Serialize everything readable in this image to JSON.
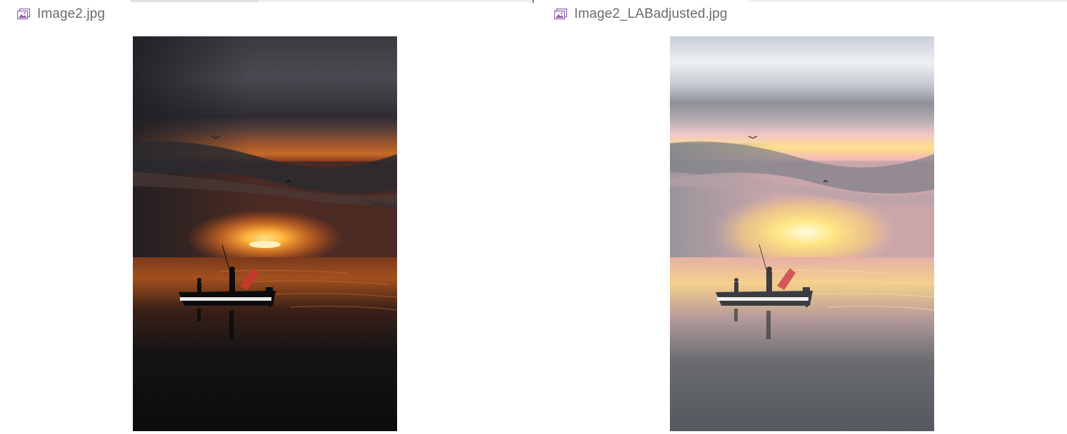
{
  "panes": [
    {
      "file_name": "Image2.jpg",
      "file_icon": "image-file-icon",
      "image_alt": "Image2.jpg"
    },
    {
      "file_name": "Image2_LABadjusted.jpg",
      "file_icon": "image-file-icon",
      "image_alt": "Image2_LABadjusted.jpg"
    }
  ],
  "colors": {
    "icon_accent": "#8e5aa8",
    "file_name_text": "#6b6b6b",
    "divider": "#e5e5e5"
  }
}
